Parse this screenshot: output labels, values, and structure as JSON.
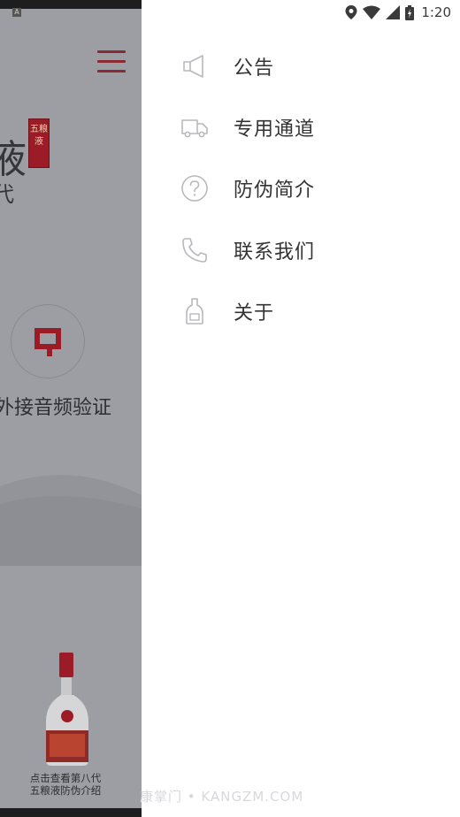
{
  "status_bar": {
    "time": "1:20",
    "icons": [
      "location-icon",
      "wifi-icon",
      "signal-icon",
      "battery-icon"
    ]
  },
  "background_app": {
    "brand_chars": [
      "液",
      "代"
    ],
    "seal_text": "五粮液",
    "voice_label": "外接音频验证",
    "bottle_caption_line1": "点击查看第八代",
    "bottle_caption_line2": "五粮液防伪介绍"
  },
  "drawer": {
    "items": [
      {
        "label": "公告",
        "icon": "megaphone-icon"
      },
      {
        "label": "专用通道",
        "icon": "truck-icon"
      },
      {
        "label": "防伪简介",
        "icon": "question-circle-icon"
      },
      {
        "label": "联系我们",
        "icon": "phone-icon"
      },
      {
        "label": "关于",
        "icon": "bottle-icon"
      }
    ]
  },
  "watermark": "康掌门 • KANGZM.COM",
  "colors": {
    "accent": "#9b1b26",
    "drawer_text": "#333333",
    "icon_stroke": "#b9b9bd"
  }
}
